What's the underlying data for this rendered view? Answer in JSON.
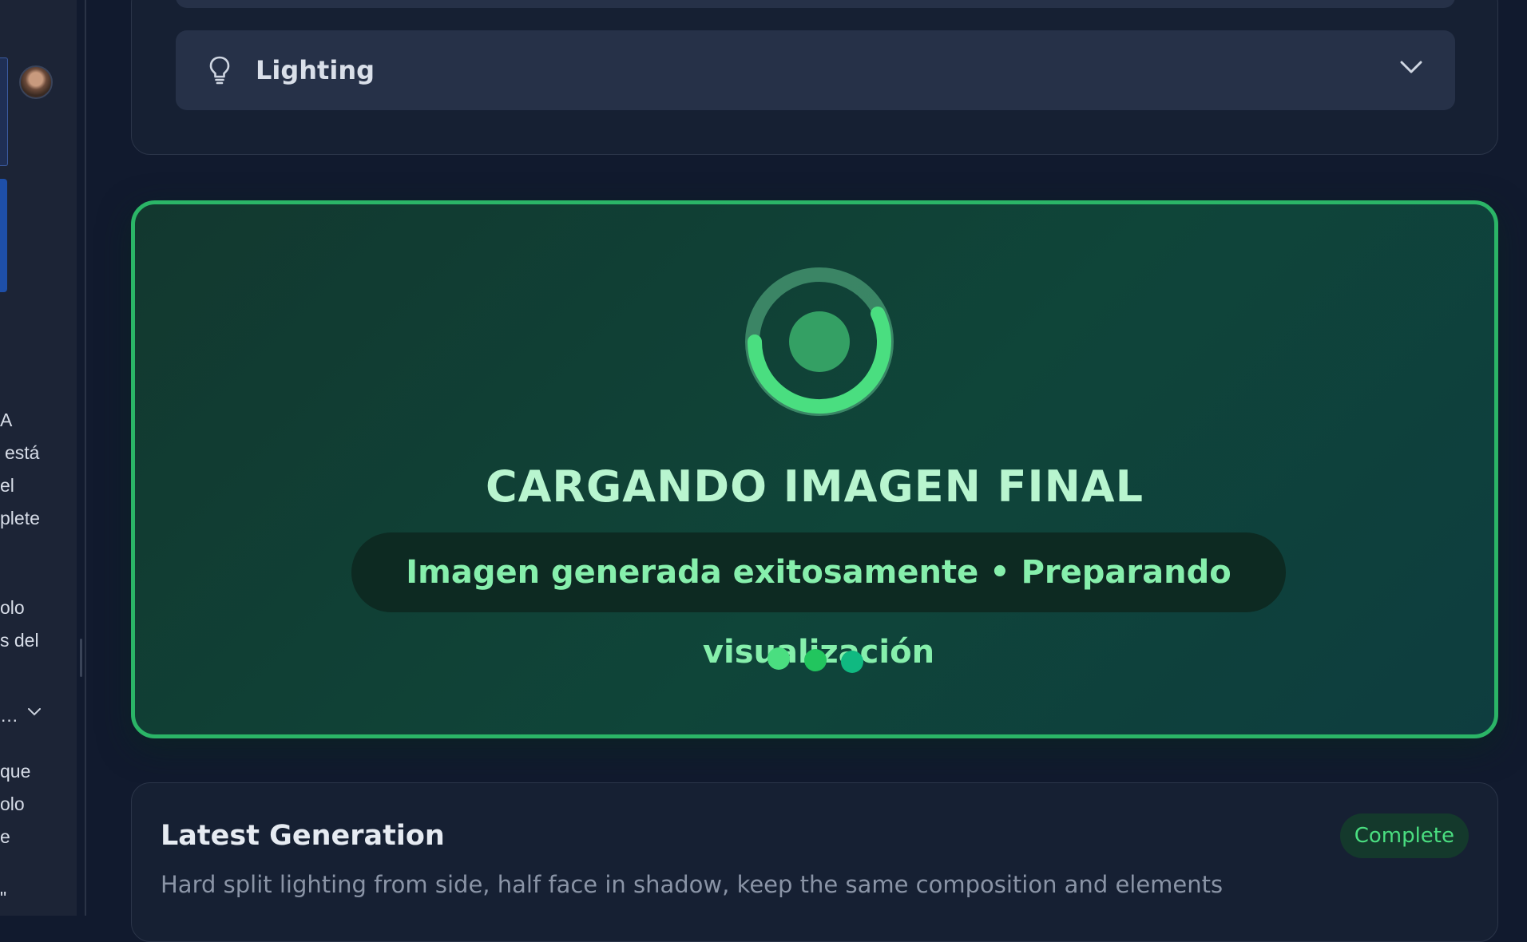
{
  "sidebar": {
    "avatar_alt": "User avatar",
    "text_fragments": [
      "A",
      "está",
      "el",
      "plete",
      "olo",
      "s del",
      "…",
      "que",
      "olo",
      "e",
      "\""
    ]
  },
  "settings": {
    "lighting_label": "Lighting"
  },
  "loading": {
    "title": "CARGANDO IMAGEN FINAL",
    "status": "Imagen generada exitosamente • Preparando visualización",
    "accent": "#2bb567",
    "dots": 3
  },
  "latest": {
    "title": "Latest Generation",
    "badge": "Complete",
    "prompt": "Hard split lighting from side, half face in shadow, keep the same composition and elements"
  },
  "icons": [
    "lightbulb-icon",
    "chevron-down-icon",
    "spinner-icon"
  ]
}
